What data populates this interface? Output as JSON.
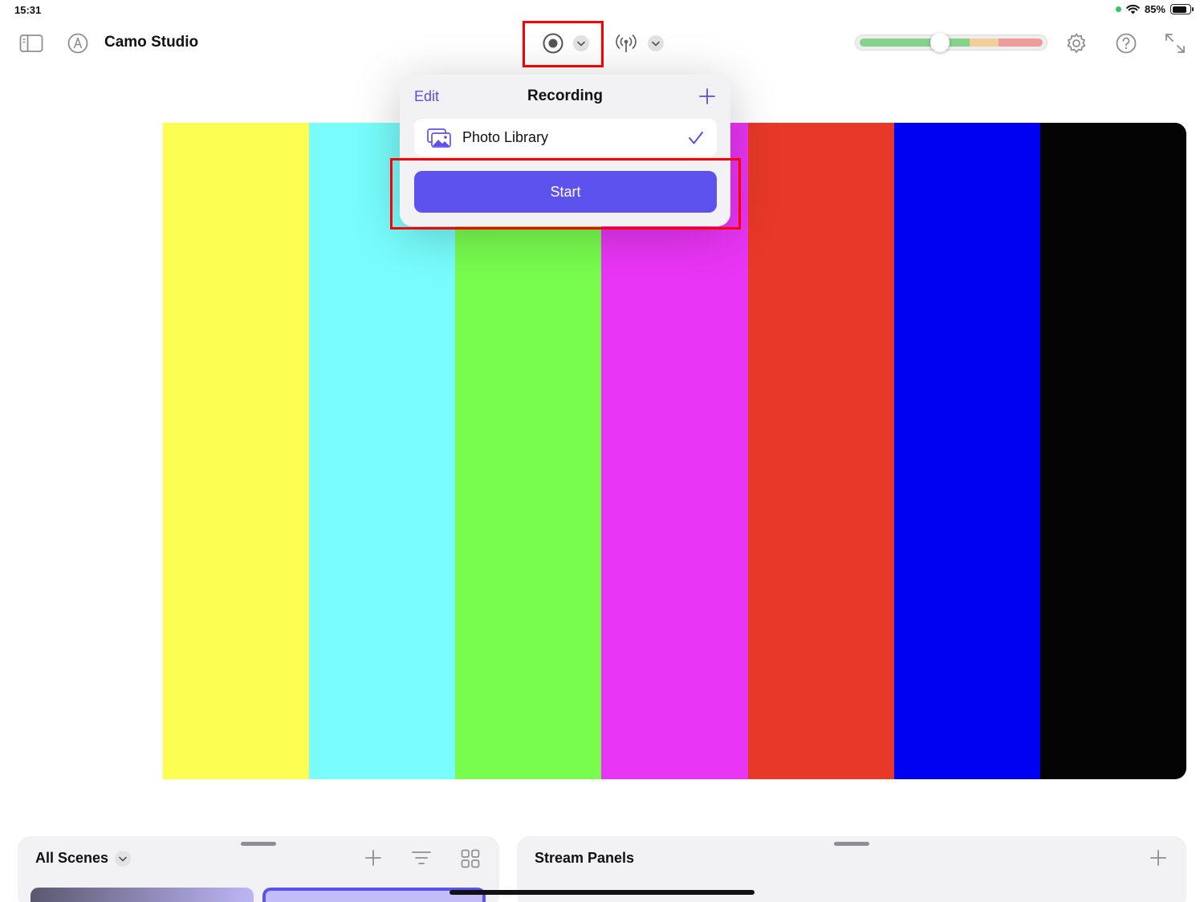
{
  "status_bar": {
    "time": "15:31",
    "battery_text": "85%",
    "battery_level": 0.85
  },
  "toolbar": {
    "app_title": "Camo Studio",
    "icons": {
      "sidebar": "sidebar-toggle-icon",
      "pen": "pen-circle-icon",
      "record": "record-icon",
      "broadcast": "broadcast-icon",
      "settings": "gear-icon",
      "help": "help-icon",
      "fullscreen": "expand-icon"
    }
  },
  "audio_meter": {
    "level": 0.44,
    "colors": {
      "low": "#86d28a",
      "mid": "#f2cf9a",
      "high": "#ee9b9b"
    }
  },
  "preview": {
    "bar_colors": [
      "#fdfe52",
      "#78fcfc",
      "#78fc4e",
      "#e935f5",
      "#e83828",
      "#0000f2",
      "#040404"
    ]
  },
  "recording_popover": {
    "edit_label": "Edit",
    "title": "Recording",
    "destination": {
      "label": "Photo Library",
      "selected": true
    },
    "start_label": "Start",
    "accent": "#5e52ee"
  },
  "scenes_panel": {
    "title": "All Scenes"
  },
  "stream_panel": {
    "title": "Stream Panels"
  }
}
